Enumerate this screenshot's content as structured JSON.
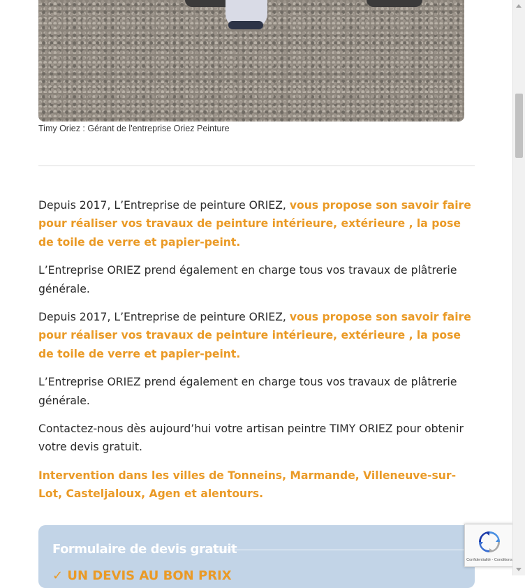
{
  "photo": {
    "caption": "Timy Oriez : Gérant de l'entreprise Oriez Peinture"
  },
  "content": {
    "p1": {
      "plain": "Depuis 2017, L’Entreprise de peinture ORIEZ, ",
      "highlight": "vous propose son savoir faire pour réaliser vos travaux de peinture intérieure, extérieure , la pose de toile de verre et papier-peint."
    },
    "p2": "L’Entreprise ORIEZ prend également en charge tous vos travaux de plâtrerie générale.",
    "p3": {
      "plain": "Depuis 2017, L’Entreprise de peinture ORIEZ, ",
      "highlight": "vous propose son savoir faire pour réaliser vos travaux de peinture intérieure, extérieure , la pose de toile de verre et papier-peint."
    },
    "p4": "L’Entreprise ORIEZ prend également en charge tous vos travaux de plâtrerie générale.",
    "p5": "Contactez-nous dès aujourd’hui votre artisan peintre TIMY ORIEZ pour obtenir votre devis gratuit.",
    "p6": "Intervention dans les villes de Tonneins, Marmande, Villeneuve-sur-Lot, Casteljaloux, Agen et alentours."
  },
  "form": {
    "title": "Formulaire de devis gratuit",
    "subtitle": "✓ UN DEVIS AU BON PRIX"
  },
  "recaptcha": {
    "terms": "Confidentialité - Conditions"
  },
  "colors": {
    "accent": "#ea9a26",
    "form_bg": "#c2d4e7"
  }
}
